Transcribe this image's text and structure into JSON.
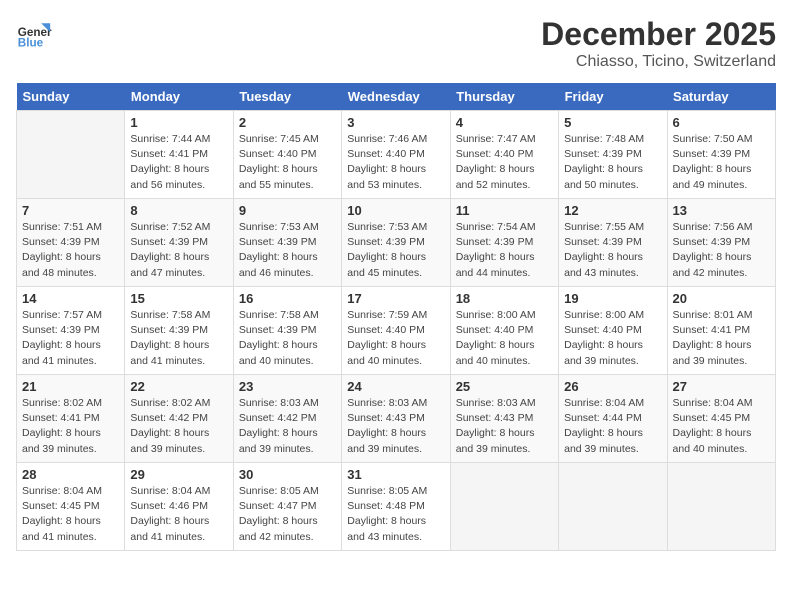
{
  "header": {
    "logo_general": "General",
    "logo_blue": "Blue",
    "month": "December 2025",
    "location": "Chiasso, Ticino, Switzerland"
  },
  "days_of_week": [
    "Sunday",
    "Monday",
    "Tuesday",
    "Wednesday",
    "Thursday",
    "Friday",
    "Saturday"
  ],
  "weeks": [
    [
      {
        "day": "",
        "empty": true
      },
      {
        "day": "1",
        "sunrise": "7:44 AM",
        "sunset": "4:41 PM",
        "daylight": "8 hours and 56 minutes."
      },
      {
        "day": "2",
        "sunrise": "7:45 AM",
        "sunset": "4:40 PM",
        "daylight": "8 hours and 55 minutes."
      },
      {
        "day": "3",
        "sunrise": "7:46 AM",
        "sunset": "4:40 PM",
        "daylight": "8 hours and 53 minutes."
      },
      {
        "day": "4",
        "sunrise": "7:47 AM",
        "sunset": "4:40 PM",
        "daylight": "8 hours and 52 minutes."
      },
      {
        "day": "5",
        "sunrise": "7:48 AM",
        "sunset": "4:39 PM",
        "daylight": "8 hours and 50 minutes."
      },
      {
        "day": "6",
        "sunrise": "7:50 AM",
        "sunset": "4:39 PM",
        "daylight": "8 hours and 49 minutes."
      }
    ],
    [
      {
        "day": "7",
        "sunrise": "7:51 AM",
        "sunset": "4:39 PM",
        "daylight": "8 hours and 48 minutes."
      },
      {
        "day": "8",
        "sunrise": "7:52 AM",
        "sunset": "4:39 PM",
        "daylight": "8 hours and 47 minutes."
      },
      {
        "day": "9",
        "sunrise": "7:53 AM",
        "sunset": "4:39 PM",
        "daylight": "8 hours and 46 minutes."
      },
      {
        "day": "10",
        "sunrise": "7:53 AM",
        "sunset": "4:39 PM",
        "daylight": "8 hours and 45 minutes."
      },
      {
        "day": "11",
        "sunrise": "7:54 AM",
        "sunset": "4:39 PM",
        "daylight": "8 hours and 44 minutes."
      },
      {
        "day": "12",
        "sunrise": "7:55 AM",
        "sunset": "4:39 PM",
        "daylight": "8 hours and 43 minutes."
      },
      {
        "day": "13",
        "sunrise": "7:56 AM",
        "sunset": "4:39 PM",
        "daylight": "8 hours and 42 minutes."
      }
    ],
    [
      {
        "day": "14",
        "sunrise": "7:57 AM",
        "sunset": "4:39 PM",
        "daylight": "8 hours and 41 minutes."
      },
      {
        "day": "15",
        "sunrise": "7:58 AM",
        "sunset": "4:39 PM",
        "daylight": "8 hours and 41 minutes."
      },
      {
        "day": "16",
        "sunrise": "7:58 AM",
        "sunset": "4:39 PM",
        "daylight": "8 hours and 40 minutes."
      },
      {
        "day": "17",
        "sunrise": "7:59 AM",
        "sunset": "4:40 PM",
        "daylight": "8 hours and 40 minutes."
      },
      {
        "day": "18",
        "sunrise": "8:00 AM",
        "sunset": "4:40 PM",
        "daylight": "8 hours and 40 minutes."
      },
      {
        "day": "19",
        "sunrise": "8:00 AM",
        "sunset": "4:40 PM",
        "daylight": "8 hours and 39 minutes."
      },
      {
        "day": "20",
        "sunrise": "8:01 AM",
        "sunset": "4:41 PM",
        "daylight": "8 hours and 39 minutes."
      }
    ],
    [
      {
        "day": "21",
        "sunrise": "8:02 AM",
        "sunset": "4:41 PM",
        "daylight": "8 hours and 39 minutes."
      },
      {
        "day": "22",
        "sunrise": "8:02 AM",
        "sunset": "4:42 PM",
        "daylight": "8 hours and 39 minutes."
      },
      {
        "day": "23",
        "sunrise": "8:03 AM",
        "sunset": "4:42 PM",
        "daylight": "8 hours and 39 minutes."
      },
      {
        "day": "24",
        "sunrise": "8:03 AM",
        "sunset": "4:43 PM",
        "daylight": "8 hours and 39 minutes."
      },
      {
        "day": "25",
        "sunrise": "8:03 AM",
        "sunset": "4:43 PM",
        "daylight": "8 hours and 39 minutes."
      },
      {
        "day": "26",
        "sunrise": "8:04 AM",
        "sunset": "4:44 PM",
        "daylight": "8 hours and 39 minutes."
      },
      {
        "day": "27",
        "sunrise": "8:04 AM",
        "sunset": "4:45 PM",
        "daylight": "8 hours and 40 minutes."
      }
    ],
    [
      {
        "day": "28",
        "sunrise": "8:04 AM",
        "sunset": "4:45 PM",
        "daylight": "8 hours and 41 minutes."
      },
      {
        "day": "29",
        "sunrise": "8:04 AM",
        "sunset": "4:46 PM",
        "daylight": "8 hours and 41 minutes."
      },
      {
        "day": "30",
        "sunrise": "8:05 AM",
        "sunset": "4:47 PM",
        "daylight": "8 hours and 42 minutes."
      },
      {
        "day": "31",
        "sunrise": "8:05 AM",
        "sunset": "4:48 PM",
        "daylight": "8 hours and 43 minutes."
      },
      {
        "day": "",
        "empty": true
      },
      {
        "day": "",
        "empty": true
      },
      {
        "day": "",
        "empty": true
      }
    ]
  ]
}
